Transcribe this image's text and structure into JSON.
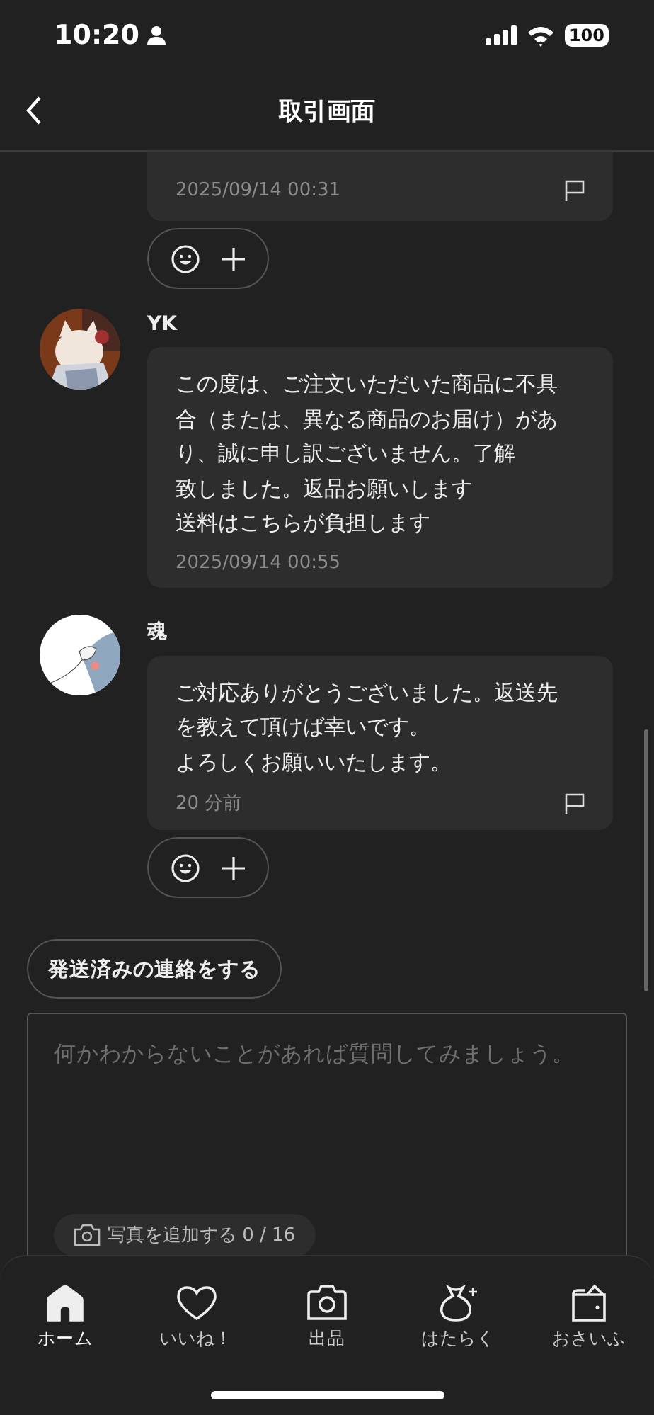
{
  "status_bar": {
    "time": "10:20",
    "battery": "100"
  },
  "header": {
    "title": "取引画面"
  },
  "messages": [
    {
      "kind": "cut",
      "time": "2025/09/14 00:31",
      "flag": true,
      "reactions": true
    },
    {
      "kind": "full",
      "sender": "YK",
      "lines": [
        "この度は、ご注文いただいた商品に不具合（または、異なる商品のお届け）があり、誠に申し訳ございません。了解",
        "致しました。返品お願いします",
        "送料はこちらが負担します"
      ],
      "time": "2025/09/14 00:55",
      "flag": false,
      "reactions": false
    },
    {
      "kind": "full",
      "sender": "魂",
      "lines": [
        "ご対応ありがとうございました。返送先を教えて頂けば幸いです。",
        "よろしくお願いいたします。"
      ],
      "time": "20 分前",
      "flag": true,
      "reactions": true
    }
  ],
  "ship_button": "発送済みの連絡をする",
  "composer": {
    "placeholder": "何かわからないことがあれば質問してみましょう。",
    "photo_button": "写真を追加する 0 / 16"
  },
  "tabs": [
    {
      "label": "ホーム",
      "kind": "home",
      "selected": true
    },
    {
      "label": "いいね！",
      "kind": "heart",
      "selected": false
    },
    {
      "label": "出品",
      "kind": "camera",
      "selected": false
    },
    {
      "label": "はたらく",
      "kind": "bag",
      "selected": false
    },
    {
      "label": "おさいふ",
      "kind": "wallet",
      "selected": false
    }
  ]
}
